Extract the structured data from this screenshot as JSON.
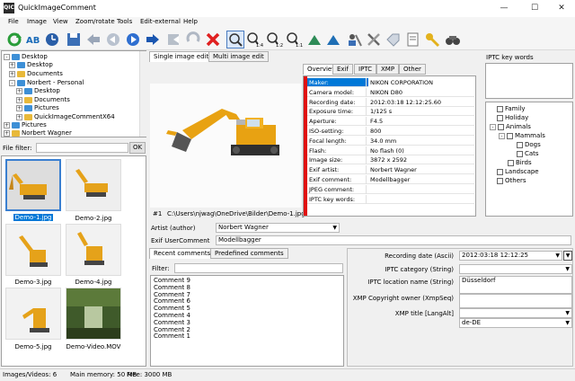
{
  "window": {
    "title": "QuickImageComment",
    "icon_text": "QIC"
  },
  "menu": [
    "File",
    "Image",
    "View",
    "Zoom/rotate",
    "Tools",
    "Edit-external",
    "Help"
  ],
  "folder_tree": [
    {
      "label": "Desktop",
      "level": 0,
      "expander": "-",
      "blue": true
    },
    {
      "label": "Desktop",
      "level": 1,
      "expander": "+",
      "blue": true
    },
    {
      "label": "Documents",
      "level": 1,
      "expander": "+",
      "blue": false
    },
    {
      "label": "Norbert - Personal",
      "level": 1,
      "expander": "-",
      "blue": true
    },
    {
      "label": "Desktop",
      "level": 2,
      "expander": "+",
      "blue": true
    },
    {
      "label": "Documents",
      "level": 2,
      "expander": "+",
      "blue": false
    },
    {
      "label": "Pictures",
      "level": 2,
      "expander": "+",
      "blue": true
    },
    {
      "label": "QuickImageCommentX64",
      "level": 2,
      "expander": "+",
      "blue": false
    },
    {
      "label": "Pictures",
      "level": 1,
      "expander": "+",
      "blue": true
    },
    {
      "label": "Norbert Wagner",
      "level": 1,
      "expander": "+",
      "blue": false
    }
  ],
  "file_filter": {
    "label": "File filter:",
    "value": "",
    "ok": "OK"
  },
  "thumbnails": [
    {
      "label": "Demo-1.jpg",
      "selected": true
    },
    {
      "label": "Demo-2.jpg",
      "selected": false
    },
    {
      "label": "Demo-3.jpg",
      "selected": false
    },
    {
      "label": "Demo-4.jpg",
      "selected": false
    },
    {
      "label": "Demo-5.jpg",
      "selected": false
    },
    {
      "label": "Demo-Video.MOV",
      "selected": false
    }
  ],
  "image_tabs": [
    "Single image edit",
    "Multi image edit"
  ],
  "image_caption": {
    "index": "#1",
    "path": "C:\\Users\\njwag\\OneDrive\\Bilder\\Demo-1.jpg"
  },
  "meta_tabs": [
    "Overview",
    "Exif",
    "IPTC",
    "XMP",
    "Other"
  ],
  "meta_rows": [
    [
      "Maker:",
      "NIKON CORPORATION"
    ],
    [
      "Camera model:",
      "NIKON D80"
    ],
    [
      "Recording date:",
      "2012:03:18 12:12:25.60"
    ],
    [
      "Exposure time:",
      "1/125 s"
    ],
    [
      "Aperture:",
      "F4.5"
    ],
    [
      "ISO-setting:",
      "800"
    ],
    [
      "Focal length:",
      "34.0 mm"
    ],
    [
      "Flash:",
      "No flash (0)"
    ],
    [
      "Image size:",
      "3872 x 2592"
    ],
    [
      "Exif artist:",
      "Norbert Wagner"
    ],
    [
      "Exif comment:",
      "Modellbagger"
    ],
    [
      "JPEG comment:",
      ""
    ],
    [
      "IPTC key words:",
      ""
    ]
  ],
  "iptc_keywords": {
    "label": "IPTC key words"
  },
  "keyword_tree": [
    {
      "label": "Family",
      "level": 0,
      "exp": ""
    },
    {
      "label": "Holiday",
      "level": 0,
      "exp": ""
    },
    {
      "label": "Animals",
      "level": 0,
      "exp": "-"
    },
    {
      "label": "Mammals",
      "level": 1,
      "exp": "-"
    },
    {
      "label": "Dogs",
      "level": 2,
      "exp": ""
    },
    {
      "label": "Cats",
      "level": 2,
      "exp": ""
    },
    {
      "label": "Birds",
      "level": 1,
      "exp": ""
    },
    {
      "label": "Landscape",
      "level": 0,
      "exp": ""
    },
    {
      "label": "Others",
      "level": 0,
      "exp": ""
    }
  ],
  "artist": {
    "label": "Artist (author)",
    "value": "Norbert Wagner"
  },
  "exif_user_comment": {
    "label": "Exif UserComment",
    "value": "Modellbagger"
  },
  "comment_tabs": [
    "Recent comments",
    "Predefined comments"
  ],
  "comment_filter_label": "Filter:",
  "comments": [
    "Comment 9",
    "Comment 8",
    "Comment 7",
    "Comment 6",
    "Comment 5",
    "Comment 4",
    "Comment 3",
    "Comment 2",
    "Comment 1"
  ],
  "properties": [
    {
      "label": "Recording date (Ascii)",
      "value": "2012:03:18 12:12:25"
    },
    {
      "label": "IPTC category (String)",
      "value": ""
    },
    {
      "label": "IPTC location name (String)",
      "value": "Düsseldorf"
    },
    {
      "label": "XMP Copyright owner (XmpSeq)",
      "value": ""
    },
    {
      "label": "XMP title [LangAlt]",
      "value": ""
    },
    {
      "label": "",
      "value": "de-DE"
    }
  ],
  "status": {
    "images": "Images/Videos: 6",
    "memory": "Main memory: 50 MB",
    "free": "Free: 3000 MB"
  },
  "colors": {
    "accent": "#0078d7",
    "select": "#cde8ff",
    "meta_bar": "#e01010"
  }
}
